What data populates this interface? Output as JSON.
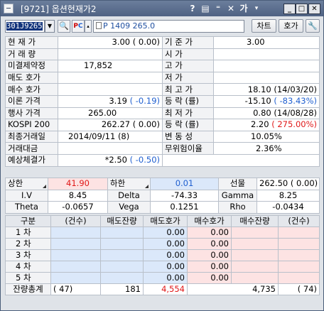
{
  "window": {
    "title": "[9721] 옵션현재가2",
    "title_glyphs": [
      "?",
      "▤",
      "⁼",
      "✕",
      "가",
      "▾"
    ]
  },
  "toolbar": {
    "code": "301J9265",
    "name": "P 1409 265.0",
    "chart_label": "차트",
    "hoga_label": "호가"
  },
  "info": [
    {
      "l1": "현 재 가",
      "v1": "3.00 (  0.00)",
      "l2": "기 준 가",
      "v2": "3.00"
    },
    {
      "l1": "거 래 량",
      "v1": "",
      "l2": "시 가",
      "v2": ""
    },
    {
      "l1": "미결제약정",
      "v1": "17,852",
      "l2": "고 가",
      "v2": ""
    },
    {
      "l1": "매도 호가",
      "v1": "",
      "l2": "저 가",
      "v2": ""
    },
    {
      "l1": "매수 호가",
      "v1": "",
      "l2": "최 고 가",
      "v2": "18.10 (14/03/20)"
    },
    {
      "l1": "이론 가격",
      "v1a": "3.19",
      "v1b": "( -0.19)",
      "l2": "등 락 (률)",
      "v2a": "-15.10",
      "v2b": "( -83.43%)"
    },
    {
      "l1": "행사 가격",
      "v1": "265.00",
      "l2": "최 저 가",
      "v2": "0.80 (14/08/28)"
    },
    {
      "l1": "KOSPI 200",
      "v1": "262.27 (  0.00)",
      "l2": "등 락 (률)",
      "v2a": "2.20",
      "v2b": "( 275.00%)"
    },
    {
      "l1": "최종거래일",
      "v1": "2014/09/11 (8)",
      "l2": "변 동 성",
      "v2": "10.05%"
    },
    {
      "l1": "거래대금",
      "v1": "",
      "l2": "무위험이율",
      "v2": "2.36%"
    },
    {
      "l1": "예상체결가",
      "v1a": "*2.50",
      "v1b": "( -0.50)",
      "l2": "",
      "v2": ""
    }
  ],
  "limits": {
    "upper_label": "상한",
    "upper_value": "41.90",
    "lower_label": "하한",
    "lower_value": "0.01",
    "futures_label": "선물",
    "futures_value": "262.50 (  0.00)"
  },
  "greeks": {
    "iv_label": "I.V",
    "iv": "8.45",
    "delta_label": "Delta",
    "delta": "-74.33",
    "gamma_label": "Gamma",
    "gamma": "8.25",
    "theta_label": "Theta",
    "theta": "-0.0657",
    "vega_label": "Vega",
    "vega": "0.1251",
    "rho_label": "Rho",
    "rho": "-0.0434"
  },
  "orderbook": {
    "headers": [
      "구분",
      "(건수)",
      "매도잔량",
      "매도호가",
      "매수호가",
      "매수잔량",
      "(건수)"
    ],
    "rows": [
      {
        "label": "1 차",
        "ask": "0.00",
        "bid": "0.00"
      },
      {
        "label": "2 차",
        "ask": "0.00",
        "bid": "0.00"
      },
      {
        "label": "3 차",
        "ask": "0.00",
        "bid": "0.00"
      },
      {
        "label": "4 차",
        "ask": "0.00",
        "bid": "0.00"
      },
      {
        "label": "5 차",
        "ask": "0.00",
        "bid": "0.00"
      }
    ],
    "total": {
      "label": "잔량총계",
      "ask_count": "(    47)",
      "ask_qty": "181",
      "diff": "4,554",
      "bid_qty": "4,735",
      "bid_count": "(    74)"
    }
  },
  "colors": {
    "titlebar": "#5a6c8e",
    "up": "#e01818",
    "down": "#1f5fd0",
    "ask_bg": "#dbe8fa",
    "bid_bg": "#fde3e3"
  }
}
